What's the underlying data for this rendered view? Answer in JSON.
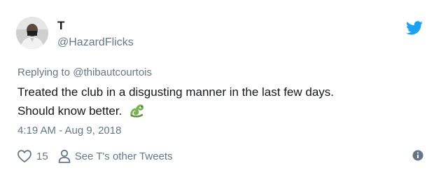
{
  "user": {
    "display_name": "T",
    "handle": "@HazardFlicks",
    "avatar": "avatar-photo"
  },
  "reply": {
    "prefix": "Replying to",
    "target": "@thibautcourtois"
  },
  "tweet": {
    "line1": "Treated the club in a disgusting manner in the last few days.",
    "line2": "Should know better.",
    "emoji": "snake-emoji"
  },
  "timestamp": "4:19 AM - Aug 9, 2018",
  "actions": {
    "like_count": "15",
    "other_tweets_label": "See T's other Tweets"
  },
  "icons": {
    "brand": "twitter-bird-icon",
    "like": "heart-icon",
    "profile": "person-icon",
    "info": "info-icon"
  },
  "colors": {
    "twitter_blue": "#1da1f2",
    "text": "#14171a",
    "secondary": "#657786",
    "link": "#1b95e0"
  }
}
